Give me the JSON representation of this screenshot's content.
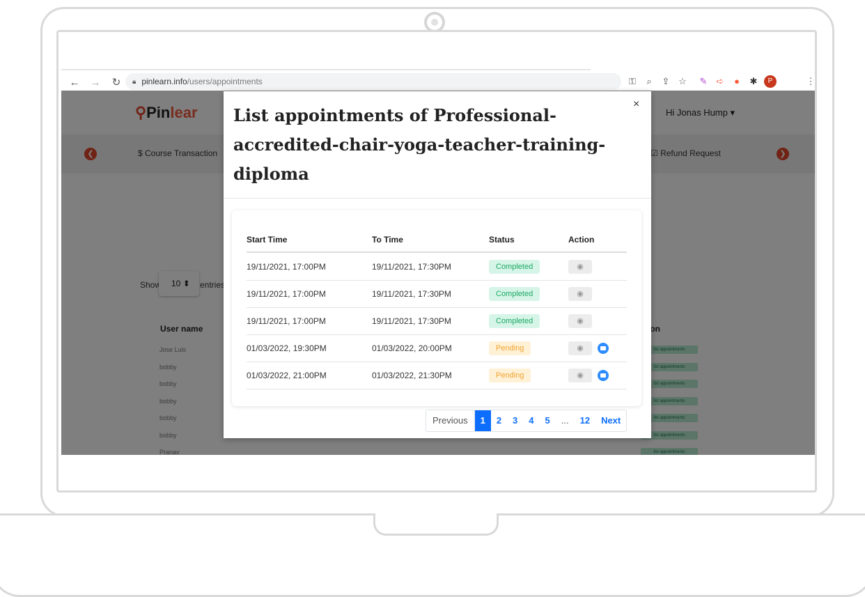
{
  "browser": {
    "url_domain": "pinlearn.info",
    "url_path": "/users/appointments"
  },
  "page": {
    "logo_prefix": "Pin",
    "logo_suffix": "lear",
    "user_greeting": "Hi Jonas Hump",
    "menu": {
      "course_transactions": "Course Transaction",
      "refund_request": "Refund Request"
    },
    "show_label": "Show",
    "entries_label": "entries",
    "entries_value": "10",
    "table_header_user": "User name",
    "table_header_action": "ion",
    "rows": [
      "Jose Luis",
      "bobby",
      "bobby",
      "bobby",
      "bobby",
      "bobby",
      "Pranav"
    ],
    "badge_text": "list appointments"
  },
  "modal": {
    "title": "List appointments of Professional-accredited-chair-yoga-teacher-training-diploma",
    "close_label": "×",
    "columns": [
      "Start Time",
      "To Time",
      "Status",
      "Action"
    ],
    "appointments": [
      {
        "start": "19/11/2021, 17:00PM",
        "end": "19/11/2021, 17:30PM",
        "status": "Completed"
      },
      {
        "start": "19/11/2021, 17:00PM",
        "end": "19/11/2021, 17:30PM",
        "status": "Completed"
      },
      {
        "start": "19/11/2021, 17:00PM",
        "end": "19/11/2021, 17:30PM",
        "status": "Completed"
      },
      {
        "start": "01/03/2022, 19:30PM",
        "end": "01/03/2022, 20:00PM",
        "status": "Pending"
      },
      {
        "start": "01/03/2022, 21:00PM",
        "end": "01/03/2022, 21:30PM",
        "status": "Pending"
      }
    ],
    "pagination": {
      "previous": "Previous",
      "pages": [
        "1",
        "2",
        "3",
        "4",
        "5"
      ],
      "ellipsis": "...",
      "last": "12",
      "next": "Next"
    }
  },
  "colors": {
    "brand": "#f05a3e",
    "completed": "#1ba862",
    "pending": "#f0a32e",
    "link": "#0d6efd"
  }
}
